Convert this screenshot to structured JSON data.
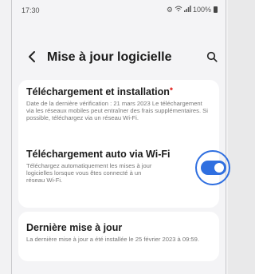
{
  "status_bar": {
    "time": "17:30",
    "battery_text": "100%"
  },
  "header": {
    "back_icon": "chevron-left-icon",
    "title": "Mise à jour logicielle",
    "search_icon": "search-icon"
  },
  "items": [
    {
      "title": "Téléchargement et installation",
      "has_dot": true,
      "description": "Date de la dernière vérification : 21 mars 2023 Le téléchargement via les réseaux mobiles peut entraîner des frais supplémentaires. Si possible, téléchargez via un réseau Wi-Fi."
    },
    {
      "title": "Téléchargement auto via Wi-Fi",
      "description": "Téléchargez automatiquement les mises à jour logicielles lorsque vous êtes connecté à un réseau Wi-Fi.",
      "toggle_on": true
    },
    {
      "title": "Dernière mise à jour",
      "description": "La dernière mise à jour a été installée le 25 février 2023 à 09:59."
    }
  ],
  "colors": {
    "accent": "#2f6fe0",
    "dot": "#e53935"
  }
}
